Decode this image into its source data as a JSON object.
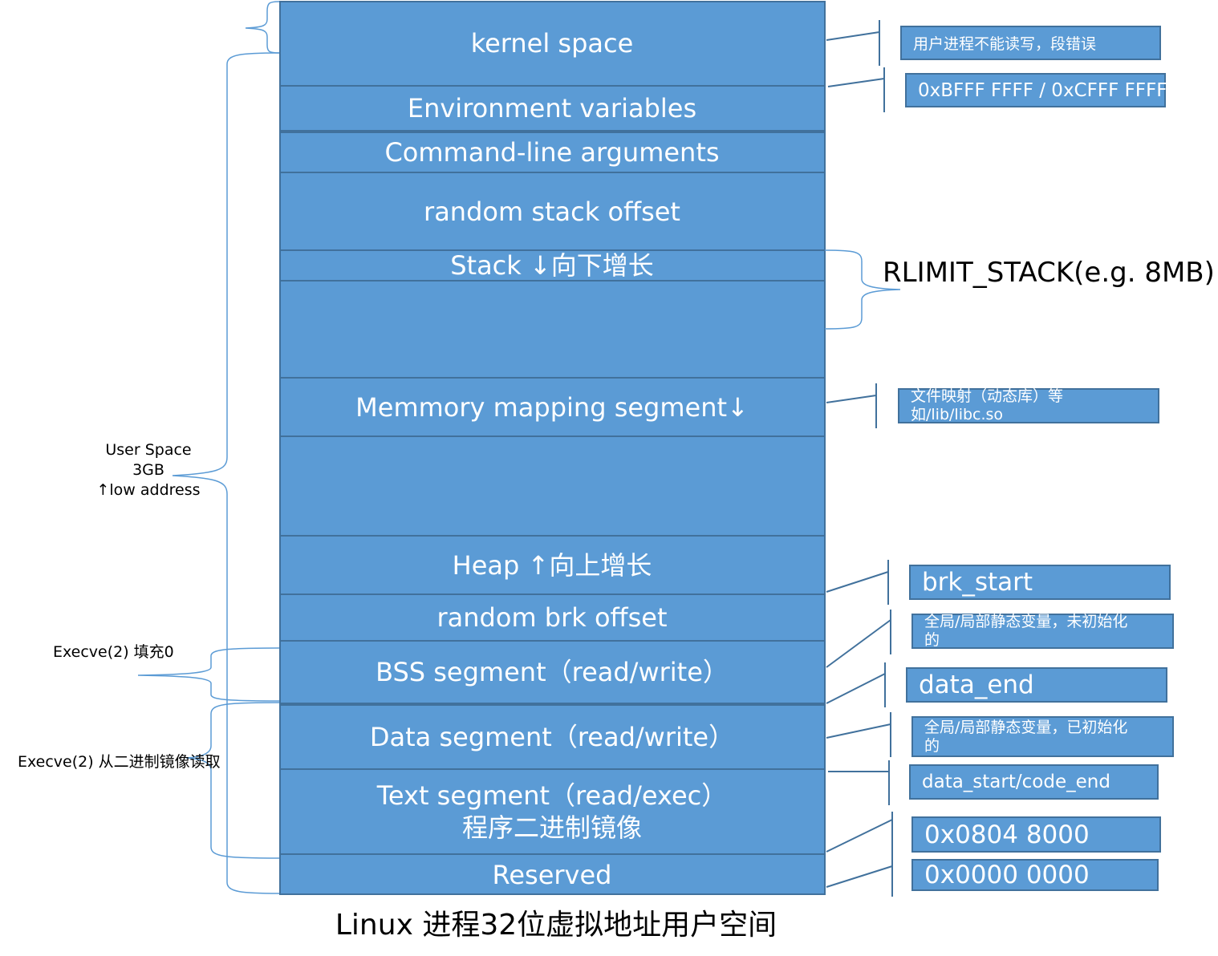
{
  "title": "Linux 进程32位虚拟地址用户空间",
  "segments": {
    "kernel": "kernel space",
    "env": "Environment variables",
    "cmdline": "Command-line arguments",
    "random_stack": "random stack offset",
    "stack": "Stack ↓向下增长",
    "empty1": "",
    "mmap": "Memmory mapping segment↓",
    "empty2": "",
    "heap": "Heap ↑向上增长",
    "random_brk": "random brk offset",
    "bss": "BSS segment（read/write）",
    "data": "Data segment（read/write）",
    "text_line1": "Text segment（read/exec）",
    "text_line2": "程序二进制镜像",
    "reserved": "Reserved"
  },
  "annotations": {
    "kernel_note": "用户进程不能读写，段错误",
    "kernel_addr": "0xBFFF FFFF / 0xCFFF FFFF",
    "rlimit": "RLIMIT_STACK(e.g. 8MB)",
    "mmap_note_line1": "文件映射（动态库）等",
    "mmap_note_line2": "如/lib/libc.so",
    "brk_start": "brk_start",
    "bss_note_line1": "全局/局部静态变量，未初始化",
    "bss_note_line2": "的",
    "data_end": "data_end",
    "data_note_line1": "全局/局部静态变量，已初始化",
    "data_note_line2": "的",
    "data_start": "data_start/code_end",
    "text_addr": "0x0804 8000",
    "zero_addr": "0x0000 0000"
  },
  "left_labels": {
    "user_space_line1": "User Space",
    "user_space_line2": "3GB",
    "user_space_line3": "↑low address",
    "bss_fill": "Execve(2) 填充0",
    "exec_read": "Execve(2) 从二进制镜像读取"
  },
  "colors": {
    "segment_fill": "#5b9bd5",
    "segment_border": "#41719c",
    "connector": "#41719c",
    "brace": "#5b9bd5"
  }
}
